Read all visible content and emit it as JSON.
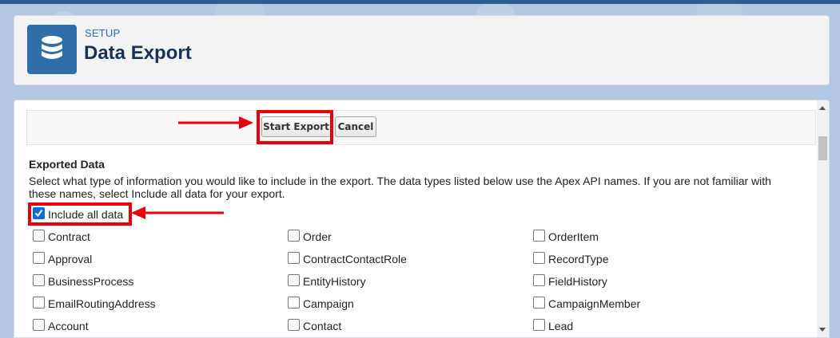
{
  "header": {
    "section_label": "SETUP",
    "title": "Data Export",
    "icon": "database-icon"
  },
  "toolbar": {
    "start_export_label": "Start Export",
    "cancel_label": "Cancel"
  },
  "exported_data": {
    "heading": "Exported Data",
    "description": "Select what type of information you would like to include in the export. The data types listed below use the Apex API names. If you are not familiar with these names, select Include all data for your export.",
    "include_all": {
      "label": "Include all data",
      "checked": true
    },
    "columns": [
      [
        "Contract",
        "Approval",
        "BusinessProcess",
        "EmailRoutingAddress",
        "Account"
      ],
      [
        "Order",
        "ContractContactRole",
        "EntityHistory",
        "Campaign",
        "Contact"
      ],
      [
        "OrderItem",
        "RecordType",
        "FieldHistory",
        "CampaignMember",
        "Lead"
      ]
    ]
  },
  "annotations": {
    "highlight_color": "#e8000b"
  }
}
